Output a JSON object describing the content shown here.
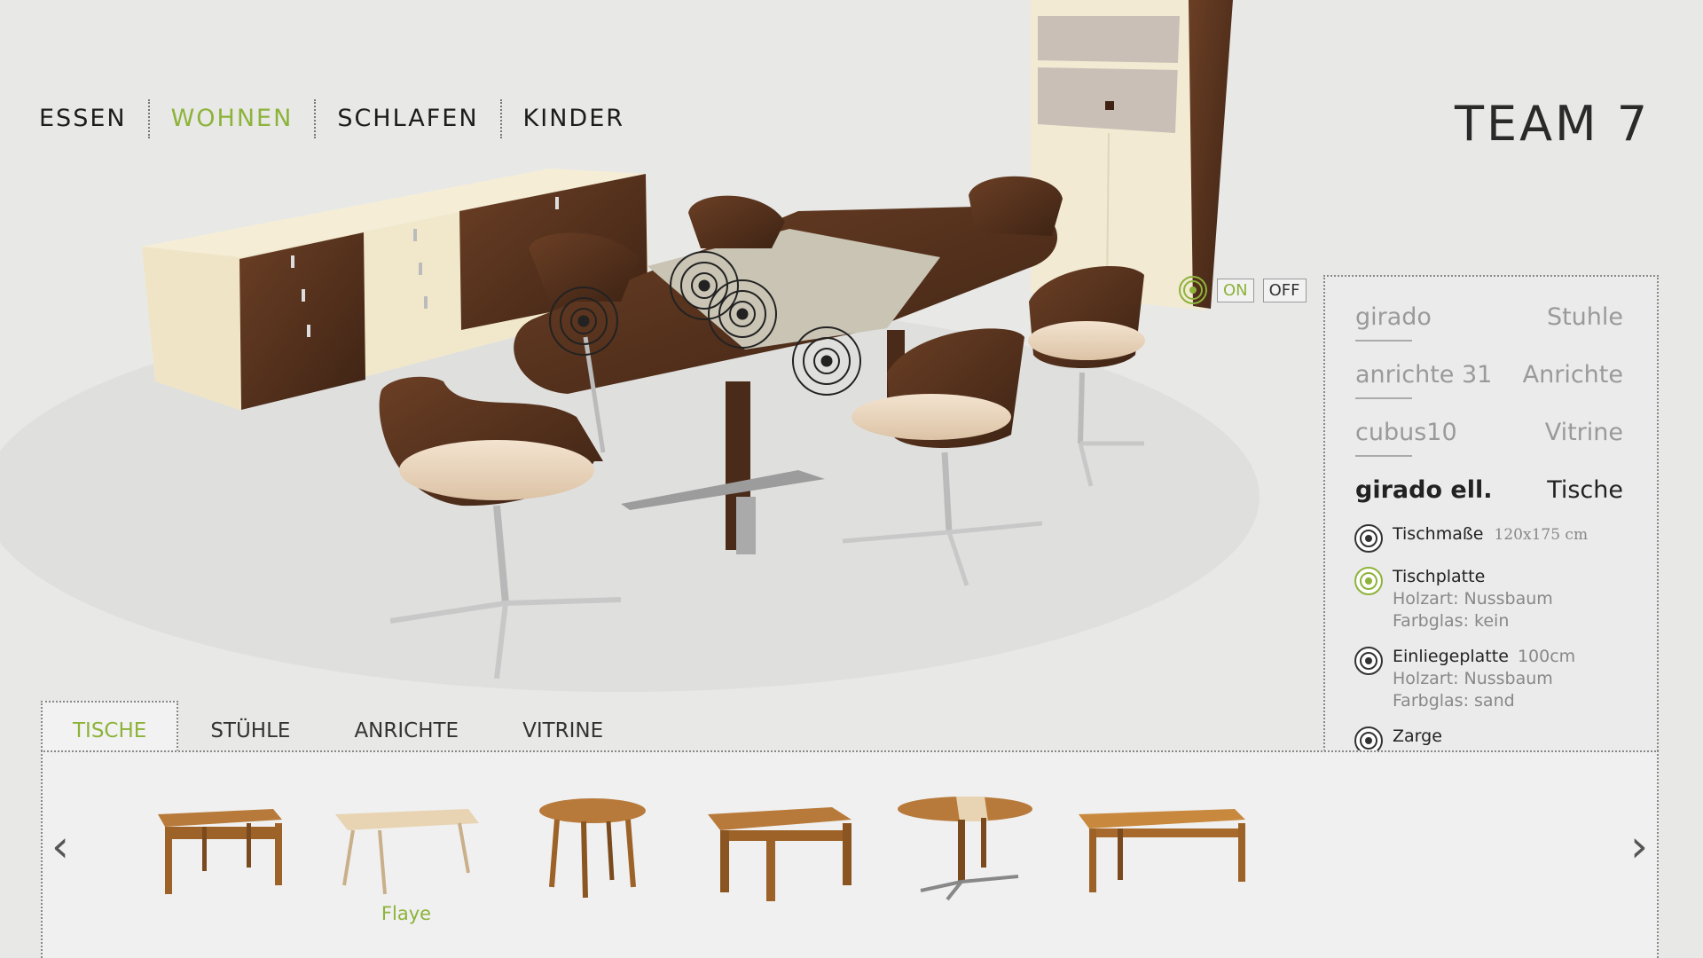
{
  "nav": {
    "items": [
      {
        "label": "ESSEN",
        "active": false
      },
      {
        "label": "WOHNEN",
        "active": true
      },
      {
        "label": "SCHLAFEN",
        "active": false
      },
      {
        "label": "KINDER",
        "active": false
      }
    ]
  },
  "logo": {
    "text": "TEAM 7"
  },
  "hotspots_toggle": {
    "on_label": "ON",
    "off_label": "OFF",
    "state": "on"
  },
  "panel": {
    "products": [
      {
        "name": "girado",
        "category": "Stuhle",
        "active": false
      },
      {
        "name": "anrichte 31",
        "category": "Anrichte",
        "active": false
      },
      {
        "name": "cubus10",
        "category": "Vitrine",
        "active": false
      },
      {
        "name": "girado ell.",
        "category": "Tische",
        "active": true
      }
    ],
    "options": [
      {
        "title": "Tischmaße",
        "value": "120x175 cm",
        "details": [],
        "highlighted": false
      },
      {
        "title": "Tischplatte",
        "value": "",
        "details": [
          "Holzart: Nussbaum",
          "Farbglas: kein"
        ],
        "highlighted": true
      },
      {
        "title": "Einliegeplatte",
        "value": "100cm",
        "details": [
          "Holzart: Nussbaum",
          "Farbglas: sand"
        ],
        "highlighted": false
      },
      {
        "title": "Zarge",
        "value": "",
        "details": [],
        "highlighted": false
      }
    ]
  },
  "tabs": [
    {
      "label": "TISCHE",
      "active": true
    },
    {
      "label": "STÜHLE",
      "active": false
    },
    {
      "label": "ANRICHTE",
      "active": false
    },
    {
      "label": "VITRINE",
      "active": false
    }
  ],
  "carousel": {
    "prev_icon": "chevron-left-icon",
    "next_icon": "chevron-right-icon",
    "items": [
      {
        "style": "square-legs",
        "label": ""
      },
      {
        "style": "flaye",
        "label": "Flaye"
      },
      {
        "style": "round",
        "label": ""
      },
      {
        "style": "frame-legs",
        "label": ""
      },
      {
        "style": "oval-extension",
        "label": ""
      },
      {
        "style": "long-frame",
        "label": ""
      }
    ]
  },
  "colors": {
    "accent": "#8db33a",
    "walnut": "#5a3420",
    "cream": "#f1e9cf"
  }
}
